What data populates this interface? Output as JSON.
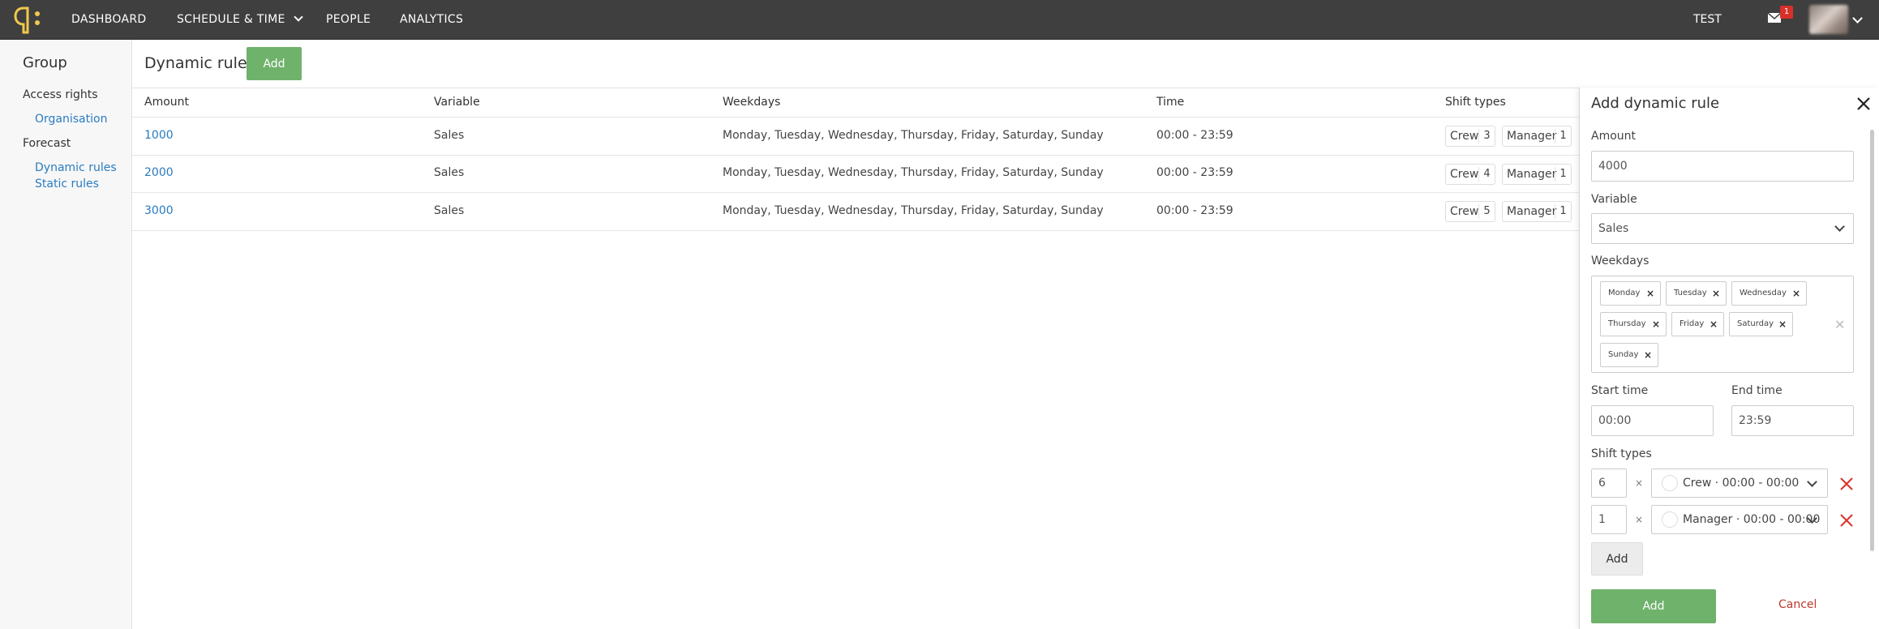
{
  "nav": {
    "items": [
      {
        "label": "DASHBOARD"
      },
      {
        "label": "SCHEDULE & TIME"
      },
      {
        "label": "PEOPLE"
      },
      {
        "label": "ANALYTICS"
      }
    ],
    "org": "TEST",
    "mail_count": "1"
  },
  "sidebar": {
    "title": "Group",
    "access_rights": "Access rights",
    "organisation": "Organisation",
    "forecast": "Forecast",
    "dynamic_rules": "Dynamic rules",
    "static_rules": "Static rules"
  },
  "main": {
    "title": "Dynamic rules",
    "add_label": "Add",
    "columns": [
      "Amount",
      "Variable",
      "Weekdays",
      "Time",
      "Shift types"
    ],
    "rows": [
      {
        "amount": "1000",
        "variable": "Sales",
        "weekdays": "Monday, Tuesday, Wednesday, Thursday, Friday, Saturday, Sunday",
        "time": "00:00 - 23:59",
        "shifts": [
          {
            "name": "Crew",
            "count": "3"
          },
          {
            "name": "Manager",
            "count": "1"
          }
        ]
      },
      {
        "amount": "2000",
        "variable": "Sales",
        "weekdays": "Monday, Tuesday, Wednesday, Thursday, Friday, Saturday, Sunday",
        "time": "00:00 - 23:59",
        "shifts": [
          {
            "name": "Crew",
            "count": "4"
          },
          {
            "name": "Manager",
            "count": "1"
          }
        ]
      },
      {
        "amount": "3000",
        "variable": "Sales",
        "weekdays": "Monday, Tuesday, Wednesday, Thursday, Friday, Saturday, Sunday",
        "time": "00:00 - 23:59",
        "shifts": [
          {
            "name": "Crew",
            "count": "5"
          },
          {
            "name": "Manager",
            "count": "1"
          }
        ]
      }
    ]
  },
  "panel": {
    "title": "Add dynamic rule",
    "amount_label": "Amount",
    "amount_value": "4000",
    "variable_label": "Variable",
    "variable_value": "Sales",
    "weekdays_label": "Weekdays",
    "weekdays": [
      "Monday",
      "Tuesday",
      "Wednesday",
      "Thursday",
      "Friday",
      "Saturday",
      "Sunday"
    ],
    "start_label": "Start time",
    "start_value": "00:00",
    "end_label": "End time",
    "end_value": "23:59",
    "shift_types_label": "Shift types",
    "shift_rows": [
      {
        "qty": "6",
        "type": "Crew · 00:00 - 00:00"
      },
      {
        "qty": "1",
        "type": "Manager · 00:00 - 00:00"
      }
    ],
    "multiply": "×",
    "add_shift_label": "Add",
    "submit_label": "Add",
    "cancel_label": "Cancel"
  },
  "colors": {
    "topbar": "#3f3f3f",
    "accent_green": "#6fb26b",
    "link_blue": "#2a7bc0",
    "danger_red": "#d9302a",
    "logo_yellow": "#f2c94c"
  }
}
